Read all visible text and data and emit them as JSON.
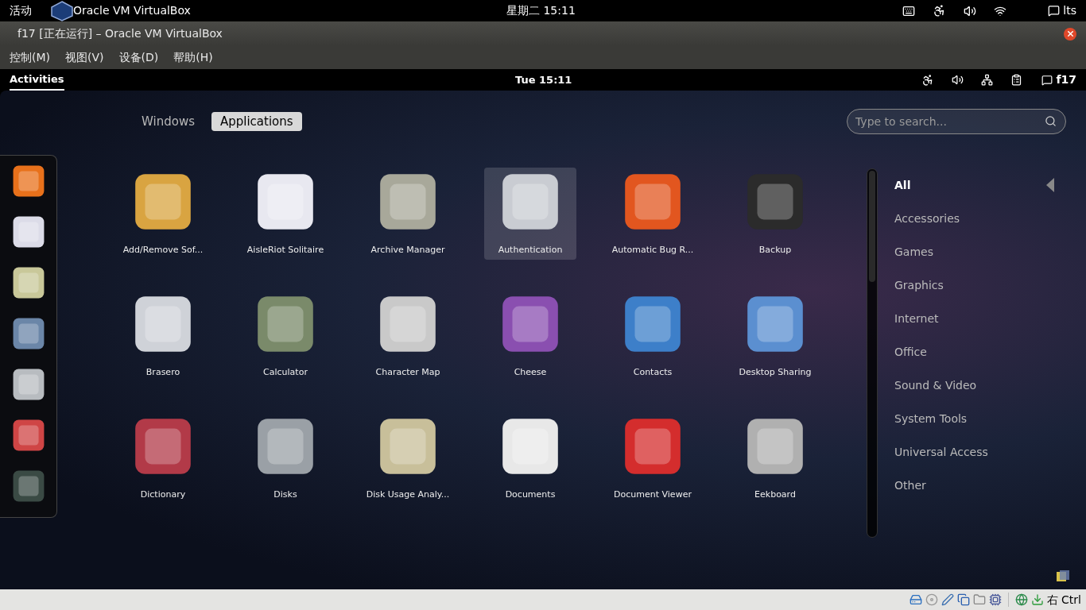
{
  "host_panel": {
    "activities": "活动",
    "app_name": "Oracle VM VirtualBox",
    "clock": "星期二 15:11",
    "user": "lts"
  },
  "window": {
    "title": "f17 [正在运行] – Oracle VM VirtualBox"
  },
  "menu": [
    "控制(M)",
    "视图(V)",
    "设备(D)",
    "帮助(H)"
  ],
  "guest_panel": {
    "activities": {
      "label": "Activities",
      "selected": true
    },
    "clock": "Tue 15:11",
    "user": "f17"
  },
  "view_tabs": [
    {
      "label": "Windows",
      "selected": false
    },
    {
      "label": "Applications",
      "selected": true
    }
  ],
  "search": {
    "placeholder": "Type to search..."
  },
  "applications": [
    {
      "name": "Add/Remove Sof...",
      "selected": false
    },
    {
      "name": "AisleRiot Solitaire",
      "selected": false
    },
    {
      "name": "Archive Manager",
      "selected": false
    },
    {
      "name": "Authentication",
      "selected": true
    },
    {
      "name": "Automatic Bug R...",
      "selected": false
    },
    {
      "name": "Backup",
      "selected": false
    },
    {
      "name": "Brasero",
      "selected": false
    },
    {
      "name": "Calculator",
      "selected": false
    },
    {
      "name": "Character Map",
      "selected": false
    },
    {
      "name": "Cheese",
      "selected": false
    },
    {
      "name": "Contacts",
      "selected": false
    },
    {
      "name": "Desktop Sharing",
      "selected": false
    },
    {
      "name": "Dictionary",
      "selected": false
    },
    {
      "name": "Disks",
      "selected": false
    },
    {
      "name": "Disk Usage Analy...",
      "selected": false
    },
    {
      "name": "Documents",
      "selected": false
    },
    {
      "name": "Document Viewer",
      "selected": false
    },
    {
      "name": "Eekboard",
      "selected": false
    }
  ],
  "categories": [
    {
      "label": "All",
      "selected": true
    },
    {
      "label": "Accessories",
      "selected": false
    },
    {
      "label": "Games",
      "selected": false
    },
    {
      "label": "Graphics",
      "selected": false
    },
    {
      "label": "Internet",
      "selected": false
    },
    {
      "label": "Office",
      "selected": false
    },
    {
      "label": "Sound & Video",
      "selected": false
    },
    {
      "label": "System Tools",
      "selected": false
    },
    {
      "label": "Universal Access",
      "selected": false
    },
    {
      "label": "Other",
      "selected": false
    }
  ],
  "status_bar": {
    "host_key": "右 Ctrl"
  }
}
